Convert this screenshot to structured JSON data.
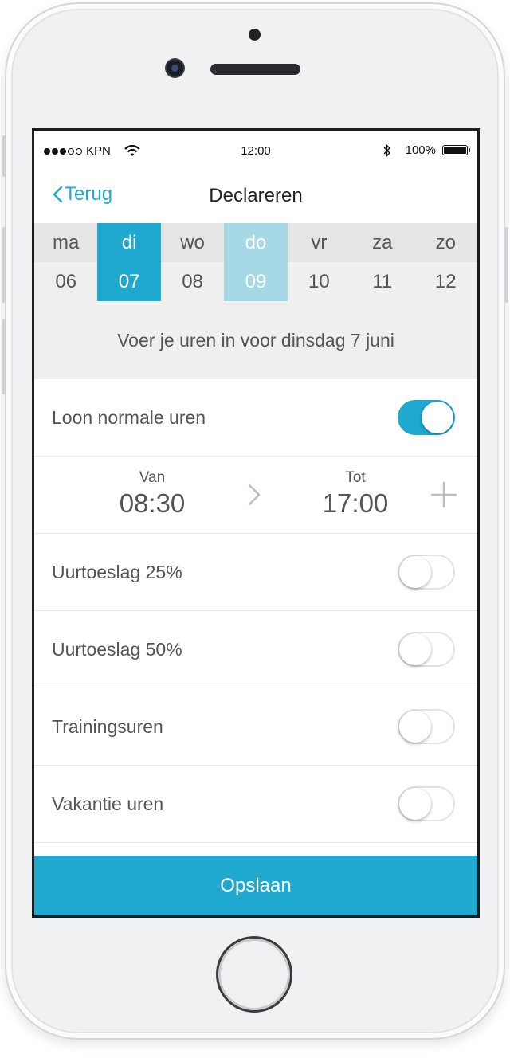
{
  "statusbar": {
    "carrier": "KPN",
    "time": "12:00",
    "battery": "100%"
  },
  "navbar": {
    "back_label": "Terug",
    "title": "Declareren"
  },
  "week": [
    {
      "name": "ma",
      "date": "06",
      "state": "normal"
    },
    {
      "name": "di",
      "date": "07",
      "state": "selected"
    },
    {
      "name": "wo",
      "date": "08",
      "state": "normal"
    },
    {
      "name": "do",
      "date": "09",
      "state": "today"
    },
    {
      "name": "vr",
      "date": "10",
      "state": "normal"
    },
    {
      "name": "za",
      "date": "11",
      "state": "normal"
    },
    {
      "name": "zo",
      "date": "12",
      "state": "normal"
    }
  ],
  "prompt": "Voer je uren in voor dinsdag 7 juni",
  "entries": [
    {
      "label": "Loon normale uren",
      "enabled": true
    },
    {
      "label": "Uurtoeslag 25%",
      "enabled": false
    },
    {
      "label": "Uurtoeslag 50%",
      "enabled": false
    },
    {
      "label": "Trainingsuren",
      "enabled": false
    },
    {
      "label": "Vakantie uren",
      "enabled": false
    }
  ],
  "time": {
    "from_label": "Van",
    "from_value": "08:30",
    "to_label": "Tot",
    "to_value": "17:00"
  },
  "save_label": "Opslaan",
  "colors": {
    "accent": "#1fa9cf",
    "today": "#a7d8e6"
  },
  "icons": {
    "back": "chevron-left-icon",
    "arrow": "chevron-right-icon",
    "add": "plus-icon",
    "wifi": "wifi-icon",
    "bluetooth": "bluetooth-icon",
    "battery": "battery-icon"
  }
}
